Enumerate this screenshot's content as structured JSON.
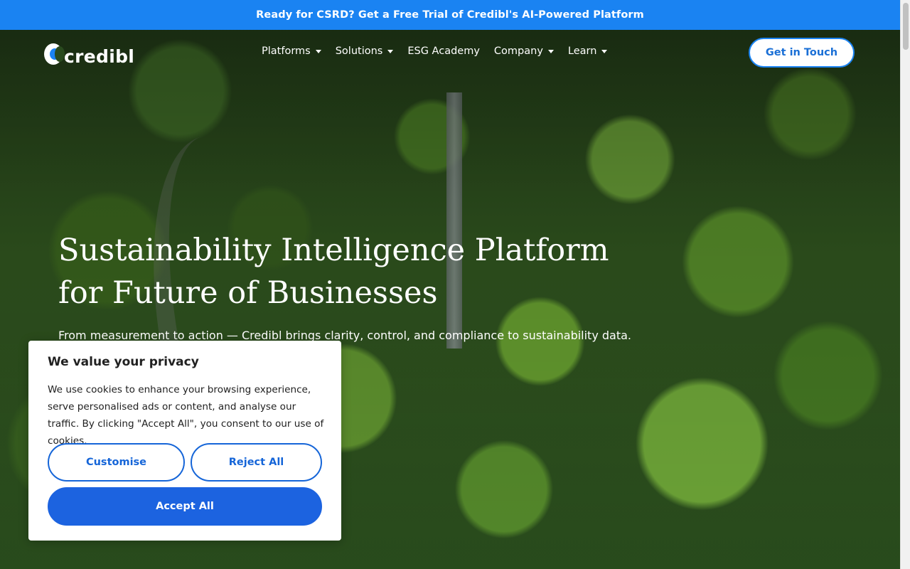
{
  "announcement": {
    "text": "Ready for CSRD? Get a Free Trial of Credibl's AI-Powered Platform"
  },
  "header": {
    "logo_text": "credibl",
    "nav": [
      {
        "label": "Platforms",
        "has_dropdown": true
      },
      {
        "label": "Solutions",
        "has_dropdown": true
      },
      {
        "label": "ESG Academy",
        "has_dropdown": false
      },
      {
        "label": "Company",
        "has_dropdown": true
      },
      {
        "label": "Learn",
        "has_dropdown": true
      }
    ],
    "cta_label": "Get in Touch"
  },
  "hero": {
    "title_line1": "Sustainability Intelligence Platform",
    "title_line2": "for Future of Businesses",
    "subtitle": "From measurement to action — Credibl brings clarity, control, and compliance to sustainability data."
  },
  "cookie_banner": {
    "title": "We value your privacy",
    "text": "We use cookies to enhance your browsing experience, serve personalised ads or content, and analyse our traffic. By clicking \"Accept All\", you consent to our use of cookies.",
    "customise_label": "Customise",
    "reject_label": "Reject All",
    "accept_label": "Accept All"
  },
  "colors": {
    "brand_blue": "#1a83f2",
    "accept_blue": "#1c63e0"
  }
}
